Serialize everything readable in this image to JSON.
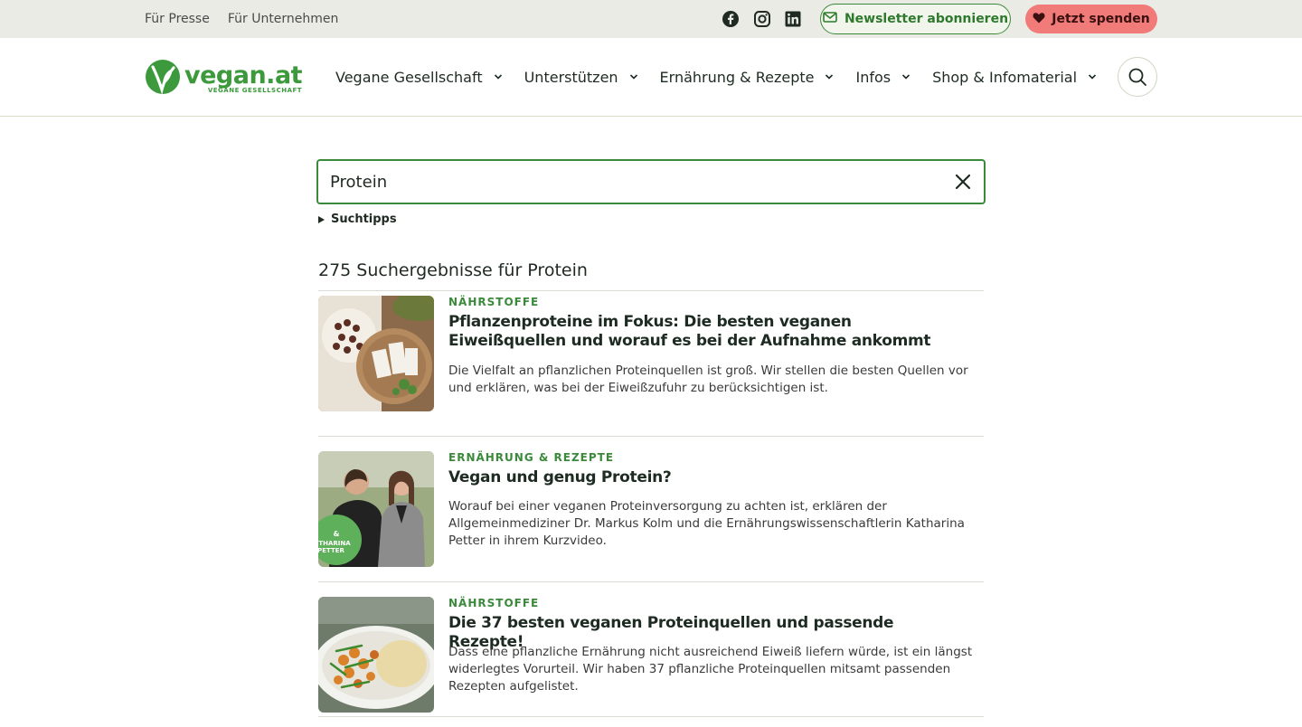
{
  "topbar": {
    "links": [
      "Für Presse",
      "Für Unternehmen"
    ],
    "social_icons": [
      "facebook-icon",
      "instagram-icon",
      "linkedin-icon"
    ],
    "newsletter_label": "Newsletter abonnieren",
    "donate_label": "Jetzt spenden"
  },
  "header": {
    "logo_text": "vegan.at",
    "logo_subtitle": "VEGANE GESELLSCHAFT",
    "nav": [
      "Vegane Gesellschaft",
      "Unterstützen",
      "Ernährung & Rezepte",
      "Infos",
      "Shop & Infomaterial"
    ]
  },
  "search": {
    "value": "Protein",
    "tips_label": "Suchtipps",
    "results_count_text": "275 Suchergebnisse für Protein"
  },
  "results": [
    {
      "category": "NÄHRSTOFFE",
      "title": "Pflanzenproteine im Fokus: Die besten veganen Eiweißquellen und worauf es bei der Aufnahme ankommt",
      "description": "Die Vielfalt an pflanzlichen Proteinquellen ist groß. Wir stellen die besten Quellen vor und erklären, was bei der Eiweißzufuhr zu berücksichtigen ist."
    },
    {
      "category": "ERNÄHRUNG & REZEPTE",
      "title": "Vegan und genug Protein?",
      "description": "Worauf bei einer veganen Proteinversorgung zu achten ist, erklären der Allgemeinmediziner Dr. Markus Kolm und die Ernährungswissenschaftlerin Katharina Petter in ihrem Kurzvideo."
    },
    {
      "category": "NÄHRSTOFFE",
      "title": "Die 37 besten veganen Proteinquellen und passende Rezepte!",
      "description": "Dass eine pflanzliche Ernährung nicht ausreichend Eiweiß liefern würde, ist ein längst widerlegtes Vorurteil. Wir haben 37 pflanzliche Proteinquellen mitsamt passenden Rezepten aufgelistet."
    }
  ],
  "colors": {
    "brand_green": "#3b8a3b",
    "donate": "#f07b78",
    "topbar_bg": "#ebebe6"
  }
}
